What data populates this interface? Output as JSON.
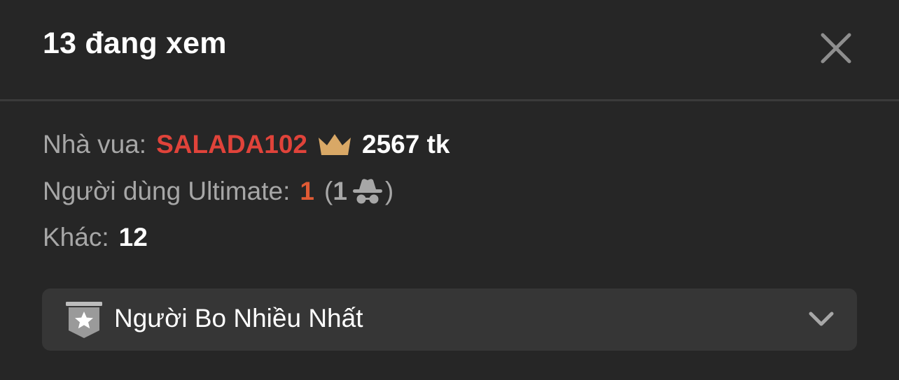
{
  "header": {
    "title": "13 đang xem",
    "close_icon": "close-icon"
  },
  "stats": {
    "king": {
      "label": "Nhà vua:",
      "name": "SALADA102",
      "icon": "crown-icon",
      "tokens": "2567 tk"
    },
    "ultimate": {
      "label": "Người dùng Ultimate:",
      "count": "1",
      "open_paren": "(",
      "anonymous_count": "1",
      "anonymous_icon": "incognito-icon",
      "close_paren": ")"
    },
    "other": {
      "label": "Khác:",
      "count": "12"
    }
  },
  "dropdown": {
    "label": "Người Bo Nhiều Nhất",
    "icon": "star-badge-icon",
    "chevron_icon": "chevron-down-icon"
  },
  "colors": {
    "background": "#262626",
    "king_name": "#e0433a",
    "ultimate_count": "#e05a34",
    "crown": "#d9a866",
    "muted_text": "#a7a7a7",
    "dropdown_bg": "#363636"
  }
}
